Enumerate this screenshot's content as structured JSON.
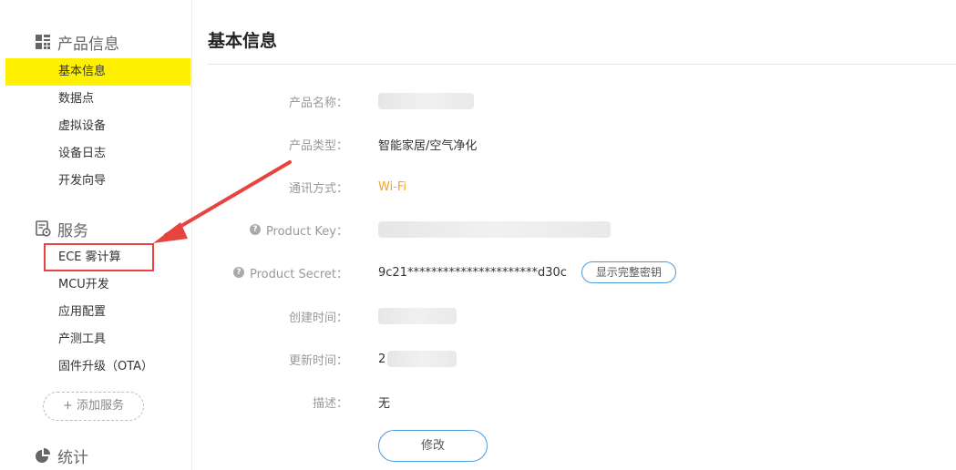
{
  "sidebar": {
    "product_section": {
      "title": "产品信息",
      "icon": "grid-icon"
    },
    "product_items": [
      {
        "label": "基本信息",
        "active": true
      },
      {
        "label": "数据点"
      },
      {
        "label": "虚拟设备"
      },
      {
        "label": "设备日志"
      },
      {
        "label": "开发向导"
      }
    ],
    "service_section": {
      "title": "服务",
      "icon": "gear-box-icon"
    },
    "service_items": [
      {
        "label": "ECE 雾计算",
        "highlighted": true
      },
      {
        "label": "MCU开发"
      },
      {
        "label": "应用配置"
      },
      {
        "label": "产测工具"
      },
      {
        "label": "固件升级（OTA）"
      }
    ],
    "add_service_label": "+ 添加服务",
    "stats_section": {
      "title": "统计",
      "icon": "pie-chart-icon"
    }
  },
  "main": {
    "title": "基本信息",
    "fields": {
      "product_name": {
        "label": "产品名称：",
        "value": ""
      },
      "product_type": {
        "label": "产品类型：",
        "value": "智能家居/空气净化"
      },
      "comm_method": {
        "label": "通讯方式：",
        "value": "Wi-Fi"
      },
      "product_key": {
        "label": "Product Key：",
        "value": ""
      },
      "product_secret": {
        "label": "Product Secret：",
        "value": "9c21**********************d30c",
        "button": "显示完整密钥"
      },
      "created_time": {
        "label": "创建时间：",
        "value": ""
      },
      "updated_time": {
        "label": "更新时间：",
        "value": "2"
      },
      "description": {
        "label": "描述：",
        "value": "无"
      }
    },
    "edit_button": "修改"
  },
  "colors": {
    "active_bg": "#fff000",
    "accent_blue": "#4a9ae0",
    "wifi_orange": "#f5a623",
    "annotation_red": "#e8443f"
  }
}
